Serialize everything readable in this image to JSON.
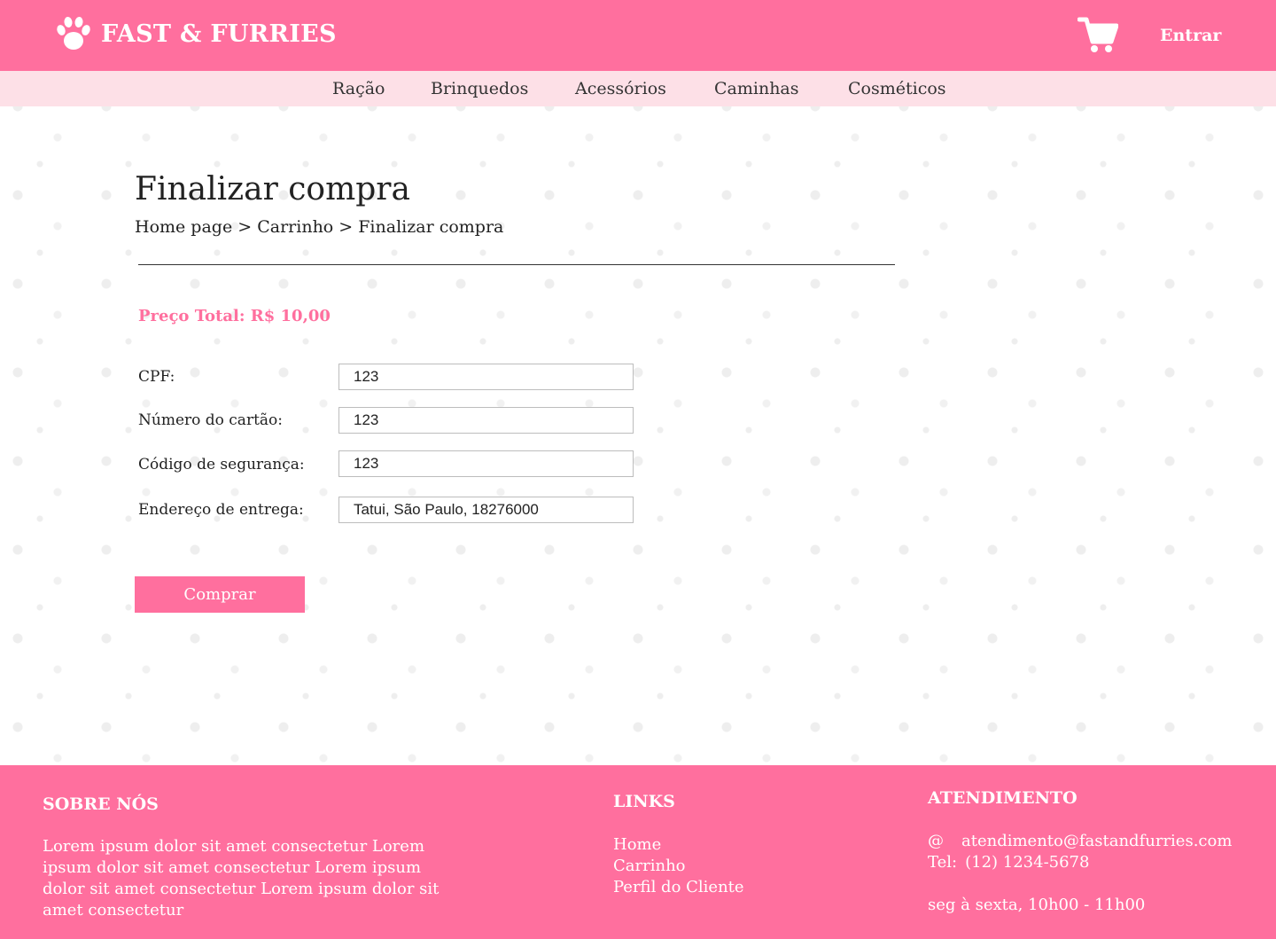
{
  "header": {
    "brand_name": "FAST & FURRIES",
    "brand_icon": "paw-icon",
    "cart_icon": "shopping-cart-icon",
    "login_label": "Entrar",
    "background_color": "#ff6f9e"
  },
  "nav": {
    "background_color": "#fde0e7",
    "items": [
      {
        "label": "Ração"
      },
      {
        "label": "Brinquedos"
      },
      {
        "label": "Acessórios"
      },
      {
        "label": "Caminhas"
      },
      {
        "label": "Cosméticos"
      }
    ]
  },
  "main": {
    "title": "Finalizar compra",
    "breadcrumb": [
      {
        "label": "Home page"
      },
      {
        "label": "Carrinho"
      },
      {
        "label": "Finalizar compra"
      }
    ],
    "breadcrumb_separator": " > ",
    "total_price": "Preço Total: R$ 10,00",
    "form": {
      "cpf": {
        "label": "CPF:",
        "value": "123"
      },
      "card_number": {
        "label": "Número do cartão:",
        "value": "123"
      },
      "security_code": {
        "label": "Código de segurança:",
        "value": "123"
      },
      "delivery_address": {
        "label": "Endereço de entrega:",
        "value": "Tatui, São Paulo, 18276000"
      }
    },
    "buy_button_label": "Comprar"
  },
  "footer": {
    "about": {
      "heading": "SOBRE NÓS",
      "text": "Lorem ipsum dolor sit amet consectetur Lorem ipsum dolor sit amet consectetur Lorem ipsum dolor sit amet consectetur Lorem ipsum dolor sit amet consectetur"
    },
    "links": {
      "heading": "LINKS",
      "items": [
        {
          "label": "Home"
        },
        {
          "label": "Carrinho"
        },
        {
          "label": "Perfil do Cliente"
        }
      ]
    },
    "support": {
      "heading": "ATENDIMENTO",
      "email_symbol": "@",
      "email": "atendimento@fastandfurries.com",
      "phone_label": "Tel:",
      "phone": "(12) 1234-5678",
      "hours": "seg à sexta, 10h00 - 11h00"
    }
  }
}
